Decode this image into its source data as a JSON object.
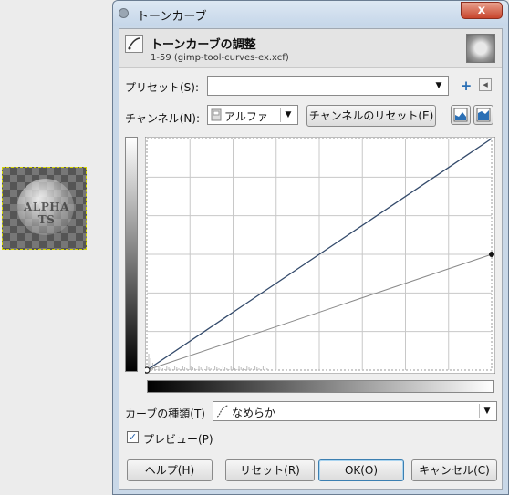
{
  "window": {
    "title": "トーンカーブ",
    "close_glyph": "x"
  },
  "header": {
    "title": "トーンカーブの調整",
    "subtitle": "1-59 (gimp-tool-curves-ex.xcf)"
  },
  "preset": {
    "label": "プリセット(S):",
    "value": "",
    "add_glyph": "+",
    "menu_glyph": "◂"
  },
  "channel": {
    "label": "チャンネル(N):",
    "value": "アルファ",
    "reset_label": "チャンネルのリセット(E)"
  },
  "curve_type": {
    "label": "カーブの種類(T)",
    "value": "なめらか"
  },
  "preview": {
    "label": "プレビュー(P)",
    "checked": true,
    "check_glyph": "✓"
  },
  "buttons": {
    "help": "ヘルプ(H)",
    "reset": "リセット(R)",
    "ok": "OK(O)",
    "cancel": "キャンセル(C)"
  },
  "thumbnail_text": "ALPHA TS",
  "colors": {
    "curve": "#334a6b",
    "reference_line": "#8a8a8a",
    "grid": "#c8c8c8",
    "close_button": "#c8452d"
  },
  "curve": {
    "identity": [
      [
        0,
        0
      ],
      [
        1,
        1
      ]
    ],
    "alpha_curve": [
      [
        0,
        0
      ],
      [
        1,
        0.5
      ]
    ],
    "control_point_end": [
      1,
      0.5
    ]
  }
}
